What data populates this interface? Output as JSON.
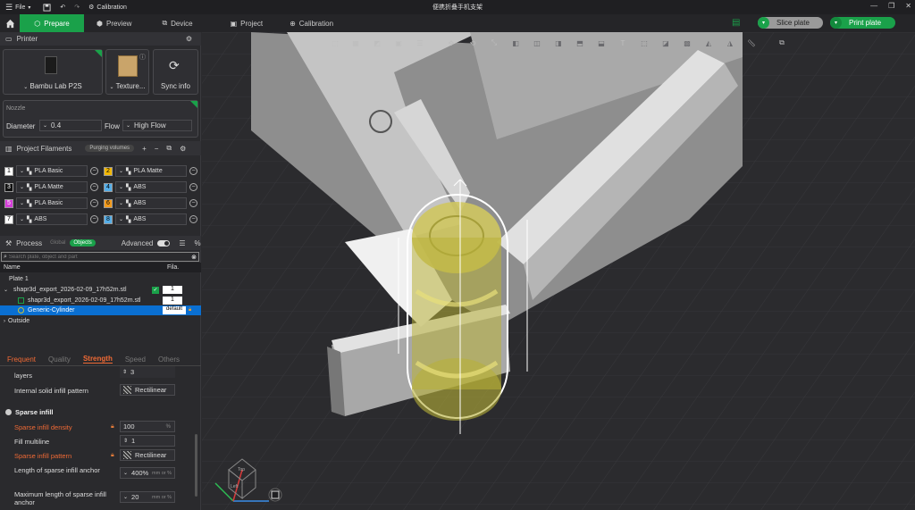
{
  "titlebar": {
    "file_label": "File",
    "calibration_label": "Calibration",
    "window_title": "便携折叠手机支架"
  },
  "nav": {
    "tabs": [
      {
        "label": "Prepare"
      },
      {
        "label": "Preview"
      },
      {
        "label": "Device"
      },
      {
        "label": "Project"
      },
      {
        "label": "Calibration"
      }
    ],
    "slice_label": "Slice plate",
    "print_label": "Print plate"
  },
  "printer": {
    "section_title": "Printer",
    "printer_name": "Bambu Lab P2S",
    "plate_type": "Texture...",
    "sync_label": "Sync info"
  },
  "nozzle": {
    "title": "Nozzle",
    "diameter_label": "Diameter",
    "diameter_value": "0.4",
    "flow_label": "Flow",
    "flow_value": "High Flow"
  },
  "filaments": {
    "title": "Project Filaments",
    "purge_label": "Purging volumes",
    "items": [
      {
        "num": "1",
        "name": "PLA Basic",
        "color": "#ffffff",
        "text": "#000"
      },
      {
        "num": "2",
        "name": "PLA Matte",
        "color": "#f2b705",
        "text": "#000"
      },
      {
        "num": "3",
        "name": "PLA Matte",
        "color": "#111111",
        "text": "#fff"
      },
      {
        "num": "4",
        "name": "ABS",
        "color": "#55aee8",
        "text": "#000"
      },
      {
        "num": "5",
        "name": "PLA Basic",
        "color": "#d43cd8",
        "text": "#fff"
      },
      {
        "num": "6",
        "name": "ABS",
        "color": "#f29a1b",
        "text": "#000"
      },
      {
        "num": "7",
        "name": "ABS",
        "color": "#ffffff",
        "text": "#000"
      },
      {
        "num": "8",
        "name": "ABS",
        "color": "#55aee8",
        "text": "#000"
      }
    ]
  },
  "process": {
    "title": "Process",
    "global_label": "Global",
    "objects_label": "Objects",
    "advanced_label": "Advanced",
    "search_placeholder": "Search plate, object and part",
    "col_name": "Name",
    "col_fila": "Fila.",
    "tree": {
      "plate": "Plate 1",
      "object": "shapr3d_export_2026-02-09_17h52m.stl",
      "object_fila": "1",
      "part": "shapr3d_export_2026-02-09_17h52m.stl",
      "part_fila": "1",
      "modifier": "Generic-Cylinder",
      "modifier_fila": "default",
      "outside": "Outside"
    },
    "tabs": [
      {
        "label": "Frequent"
      },
      {
        "label": "Quality"
      },
      {
        "label": "Strength"
      },
      {
        "label": "Speed"
      },
      {
        "label": "Others"
      }
    ]
  },
  "settings": {
    "layers_label": "layers",
    "layers_value": "3",
    "internal_solid_label": "Internal solid infill pattern",
    "internal_solid_value": "Rectilinear",
    "sparse_group": "Sparse infill",
    "density_label": "Sparse infill density",
    "density_value": "100",
    "density_unit": "%",
    "multiline_label": "Fill multiline",
    "multiline_value": "1",
    "pattern_label": "Sparse infill pattern",
    "pattern_value": "Rectilinear",
    "anchor_label": "Length of sparse infill anchor",
    "anchor_value": "400%",
    "anchor_unit": "mm or %",
    "maxanchor_label": "Maximum length of sparse infill anchor",
    "maxanchor_value": "20",
    "maxanchor_unit": "mm or %"
  },
  "viewport": {
    "axis_labels": {
      "top": "Top",
      "left": "Left"
    }
  },
  "colors": {
    "accent": "#1aa14a",
    "modifier": "#c9c23a",
    "highlight": "#0a6fd1"
  }
}
